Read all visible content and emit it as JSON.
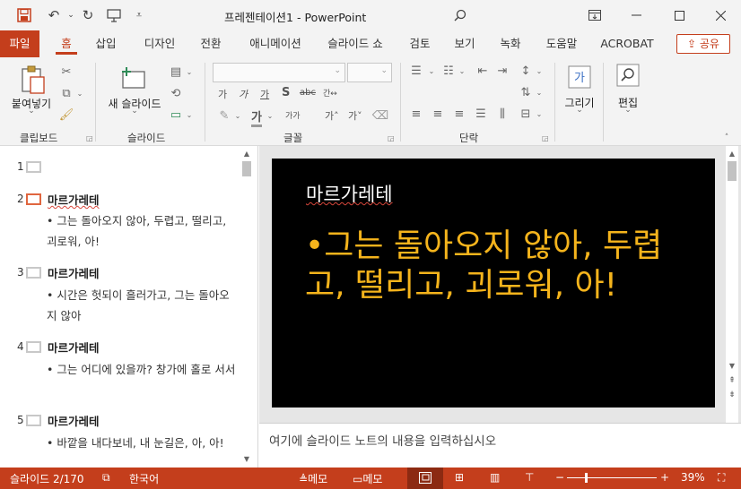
{
  "titlebar": {
    "doc_name": "프레젠테이션1",
    "separator": "-",
    "app_name": "PowerPoint",
    "qat": {
      "save_icon": "save-icon",
      "undo_icon": "undo-icon",
      "redo_icon": "redo-icon",
      "present_icon": "present-from-beginning-icon",
      "customize_icon": "customize-qat-icon"
    },
    "search_icon": "search-icon",
    "window_buttons": [
      "ribbon-display-icon",
      "minimize-icon",
      "maximize-icon",
      "close-icon"
    ]
  },
  "menu": {
    "file": "파일",
    "tabs": [
      "홈",
      "삽입",
      "디자인",
      "전환",
      "애니메이션",
      "슬라이드 쇼",
      "검토",
      "보기",
      "녹화",
      "도움말",
      "ACROBAT"
    ],
    "active_tab": "홈",
    "share": "공유"
  },
  "ribbon": {
    "clipboard": {
      "label": "클립보드",
      "paste": "붙여넣기",
      "paste_arrow": "⌄"
    },
    "slides": {
      "label": "슬라이드",
      "new_slide": "새 슬라이드",
      "new_arrow": "⌄"
    },
    "font": {
      "label": "글꼴",
      "glyphs": [
        "가",
        "가",
        "가",
        "S",
        "abc",
        "간↔",
        "가",
        "가가",
        "가˄",
        "가˅"
      ]
    },
    "paragraph": {
      "label": "단락"
    },
    "drawing": {
      "label": "그리기",
      "arrow": "⌄"
    },
    "editing": {
      "label": "편집",
      "arrow": "⌄"
    }
  },
  "outline": {
    "slides": [
      {
        "num": "1",
        "title": "",
        "bullet": ""
      },
      {
        "num": "2",
        "title": "마르가레테",
        "bullet": "그는 돌아오지 않아, 두렵고, 떨리고, 괴로워, 아!"
      },
      {
        "num": "3",
        "title": "마르가레테",
        "bullet": "시간은 헛되이 흘러가고, 그는 돌아오지 않아"
      },
      {
        "num": "4",
        "title": "마르가레테",
        "bullet": "그는 어디에 있을까? 창가에 홀로 서서"
      },
      {
        "num": "5",
        "title": "마르가레테",
        "bullet": "바깥을 내다보네, 내 눈길은, 아, 아!"
      }
    ],
    "selected": "2"
  },
  "slide": {
    "title": "마르가레테",
    "bullet": "그는 돌아오지 않아, 두렵고, 떨리고, 괴로워, 아!",
    "colors": {
      "background": "#000000",
      "title": "#ffffff",
      "body": "#f5b41c"
    }
  },
  "notes": {
    "placeholder": "여기에 슬라이드 노트의 내용을 입력하십시오"
  },
  "status": {
    "slide_counter": "슬라이드 2/170",
    "language": "한국어",
    "notes_btn": "메모",
    "comments_btn": "메모",
    "zoom_minus": "−",
    "zoom_plus": "+",
    "zoom": "39%",
    "zoom_fraction": 0.39
  },
  "colors": {
    "accent": "#c43e1c",
    "status_active": "#8c2a12",
    "outline_selected": "#e0663f"
  }
}
